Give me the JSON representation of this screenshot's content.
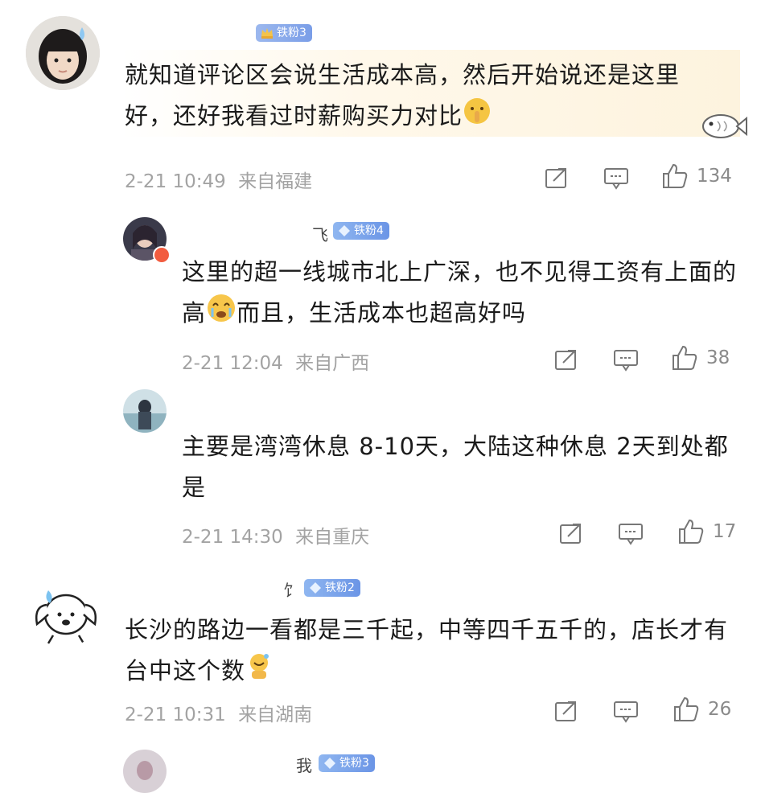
{
  "comments": [
    {
      "badge": "铁粉3",
      "text": "就知道评论区会说生活成本高，然后开始说还是这里好，还好我看过时薪购买力对比",
      "time": "2-21 10:49",
      "location": "来自福建",
      "likes": "134",
      "icons": [
        "share-icon",
        "comment-icon",
        "like-icon"
      ]
    },
    {
      "name_mark": "飞",
      "badge": "铁粉4",
      "text": "这里的超一线城市北上广深，也不见得工资有上面的高",
      "text_after": "而且，生活成本也超高好吗",
      "time": "2-21 12:04",
      "location": "来自广西",
      "likes": "38"
    },
    {
      "text": "主要是湾湾休息 8-10天，大陆这种休息 2天到处都是",
      "time": "2-21 14:30",
      "location": "来自重庆",
      "likes": "17"
    },
    {
      "name_mark": "饣",
      "badge": "铁粉2",
      "text": "长沙的路边一看都是三千起，中等四千五千的，店长才有台中这个数",
      "time": "2-21 10:31",
      "location": "来自湖南",
      "likes": "26"
    },
    {
      "name_mark": "我",
      "badge": "铁粉3"
    }
  ],
  "colors": {
    "badge": "#7a9ee8",
    "meta_text": "#a3a3a3",
    "highlight": "#fdf3de"
  }
}
